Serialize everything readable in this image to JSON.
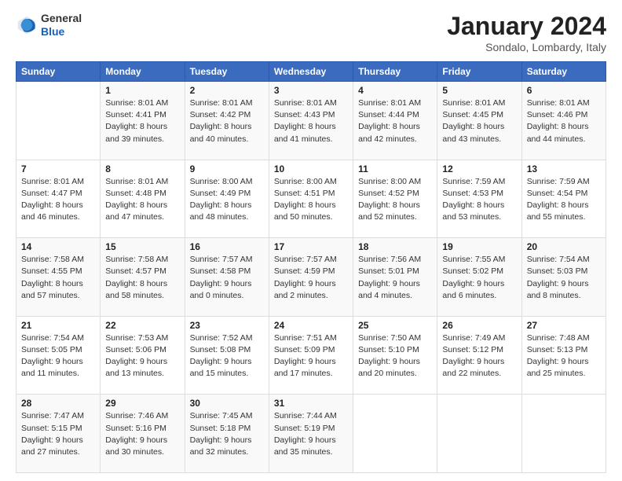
{
  "header": {
    "logo": {
      "general": "General",
      "blue": "Blue"
    },
    "title": "January 2024",
    "location": "Sondalo, Lombardy, Italy"
  },
  "days_of_week": [
    "Sunday",
    "Monday",
    "Tuesday",
    "Wednesday",
    "Thursday",
    "Friday",
    "Saturday"
  ],
  "weeks": [
    [
      {
        "day": "",
        "info": ""
      },
      {
        "day": "1",
        "info": "Sunrise: 8:01 AM\nSunset: 4:41 PM\nDaylight: 8 hours\nand 39 minutes."
      },
      {
        "day": "2",
        "info": "Sunrise: 8:01 AM\nSunset: 4:42 PM\nDaylight: 8 hours\nand 40 minutes."
      },
      {
        "day": "3",
        "info": "Sunrise: 8:01 AM\nSunset: 4:43 PM\nDaylight: 8 hours\nand 41 minutes."
      },
      {
        "day": "4",
        "info": "Sunrise: 8:01 AM\nSunset: 4:44 PM\nDaylight: 8 hours\nand 42 minutes."
      },
      {
        "day": "5",
        "info": "Sunrise: 8:01 AM\nSunset: 4:45 PM\nDaylight: 8 hours\nand 43 minutes."
      },
      {
        "day": "6",
        "info": "Sunrise: 8:01 AM\nSunset: 4:46 PM\nDaylight: 8 hours\nand 44 minutes."
      }
    ],
    [
      {
        "day": "7",
        "info": "Sunrise: 8:01 AM\nSunset: 4:47 PM\nDaylight: 8 hours\nand 46 minutes."
      },
      {
        "day": "8",
        "info": "Sunrise: 8:01 AM\nSunset: 4:48 PM\nDaylight: 8 hours\nand 47 minutes."
      },
      {
        "day": "9",
        "info": "Sunrise: 8:00 AM\nSunset: 4:49 PM\nDaylight: 8 hours\nand 48 minutes."
      },
      {
        "day": "10",
        "info": "Sunrise: 8:00 AM\nSunset: 4:51 PM\nDaylight: 8 hours\nand 50 minutes."
      },
      {
        "day": "11",
        "info": "Sunrise: 8:00 AM\nSunset: 4:52 PM\nDaylight: 8 hours\nand 52 minutes."
      },
      {
        "day": "12",
        "info": "Sunrise: 7:59 AM\nSunset: 4:53 PM\nDaylight: 8 hours\nand 53 minutes."
      },
      {
        "day": "13",
        "info": "Sunrise: 7:59 AM\nSunset: 4:54 PM\nDaylight: 8 hours\nand 55 minutes."
      }
    ],
    [
      {
        "day": "14",
        "info": "Sunrise: 7:58 AM\nSunset: 4:55 PM\nDaylight: 8 hours\nand 57 minutes."
      },
      {
        "day": "15",
        "info": "Sunrise: 7:58 AM\nSunset: 4:57 PM\nDaylight: 8 hours\nand 58 minutes."
      },
      {
        "day": "16",
        "info": "Sunrise: 7:57 AM\nSunset: 4:58 PM\nDaylight: 9 hours\nand 0 minutes."
      },
      {
        "day": "17",
        "info": "Sunrise: 7:57 AM\nSunset: 4:59 PM\nDaylight: 9 hours\nand 2 minutes."
      },
      {
        "day": "18",
        "info": "Sunrise: 7:56 AM\nSunset: 5:01 PM\nDaylight: 9 hours\nand 4 minutes."
      },
      {
        "day": "19",
        "info": "Sunrise: 7:55 AM\nSunset: 5:02 PM\nDaylight: 9 hours\nand 6 minutes."
      },
      {
        "day": "20",
        "info": "Sunrise: 7:54 AM\nSunset: 5:03 PM\nDaylight: 9 hours\nand 8 minutes."
      }
    ],
    [
      {
        "day": "21",
        "info": "Sunrise: 7:54 AM\nSunset: 5:05 PM\nDaylight: 9 hours\nand 11 minutes."
      },
      {
        "day": "22",
        "info": "Sunrise: 7:53 AM\nSunset: 5:06 PM\nDaylight: 9 hours\nand 13 minutes."
      },
      {
        "day": "23",
        "info": "Sunrise: 7:52 AM\nSunset: 5:08 PM\nDaylight: 9 hours\nand 15 minutes."
      },
      {
        "day": "24",
        "info": "Sunrise: 7:51 AM\nSunset: 5:09 PM\nDaylight: 9 hours\nand 17 minutes."
      },
      {
        "day": "25",
        "info": "Sunrise: 7:50 AM\nSunset: 5:10 PM\nDaylight: 9 hours\nand 20 minutes."
      },
      {
        "day": "26",
        "info": "Sunrise: 7:49 AM\nSunset: 5:12 PM\nDaylight: 9 hours\nand 22 minutes."
      },
      {
        "day": "27",
        "info": "Sunrise: 7:48 AM\nSunset: 5:13 PM\nDaylight: 9 hours\nand 25 minutes."
      }
    ],
    [
      {
        "day": "28",
        "info": "Sunrise: 7:47 AM\nSunset: 5:15 PM\nDaylight: 9 hours\nand 27 minutes."
      },
      {
        "day": "29",
        "info": "Sunrise: 7:46 AM\nSunset: 5:16 PM\nDaylight: 9 hours\nand 30 minutes."
      },
      {
        "day": "30",
        "info": "Sunrise: 7:45 AM\nSunset: 5:18 PM\nDaylight: 9 hours\nand 32 minutes."
      },
      {
        "day": "31",
        "info": "Sunrise: 7:44 AM\nSunset: 5:19 PM\nDaylight: 9 hours\nand 35 minutes."
      },
      {
        "day": "",
        "info": ""
      },
      {
        "day": "",
        "info": ""
      },
      {
        "day": "",
        "info": ""
      }
    ]
  ]
}
